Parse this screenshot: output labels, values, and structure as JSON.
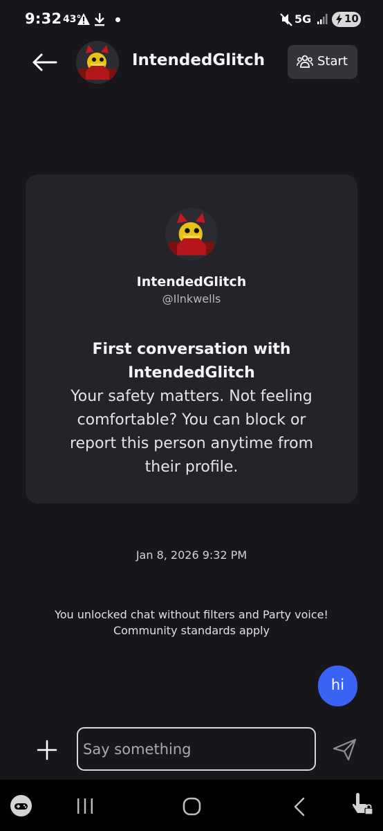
{
  "status_bar": {
    "time": "9:32",
    "temperature": "43°",
    "network": "5G",
    "battery": "10"
  },
  "header": {
    "contact_name": "IntendedGlitch",
    "start_label": "Start"
  },
  "intro_card": {
    "name": "IntendedGlitch",
    "handle": "@Ilnkwells",
    "title": "First conversation with IntendedGlitch",
    "body": "Your safety matters. Not feeling comfortable? You can block or report this person anytime from their profile."
  },
  "conversation": {
    "date_stamp": "Jan 8, 2026 9:32 PM",
    "system_message": "You unlocked chat without filters and Party voice! Community standards apply",
    "messages": [
      {
        "text": "hi",
        "from_me": true
      }
    ]
  },
  "composer": {
    "placeholder": "Say something",
    "value": ""
  },
  "colors": {
    "background": "#17171b",
    "card": "#232328",
    "bubble": "#3a63f5",
    "start_button": "#34353b"
  },
  "icons": {
    "back": "arrow-left-icon",
    "start": "people-icon",
    "add": "plus-icon",
    "send": "paper-plane-icon"
  }
}
